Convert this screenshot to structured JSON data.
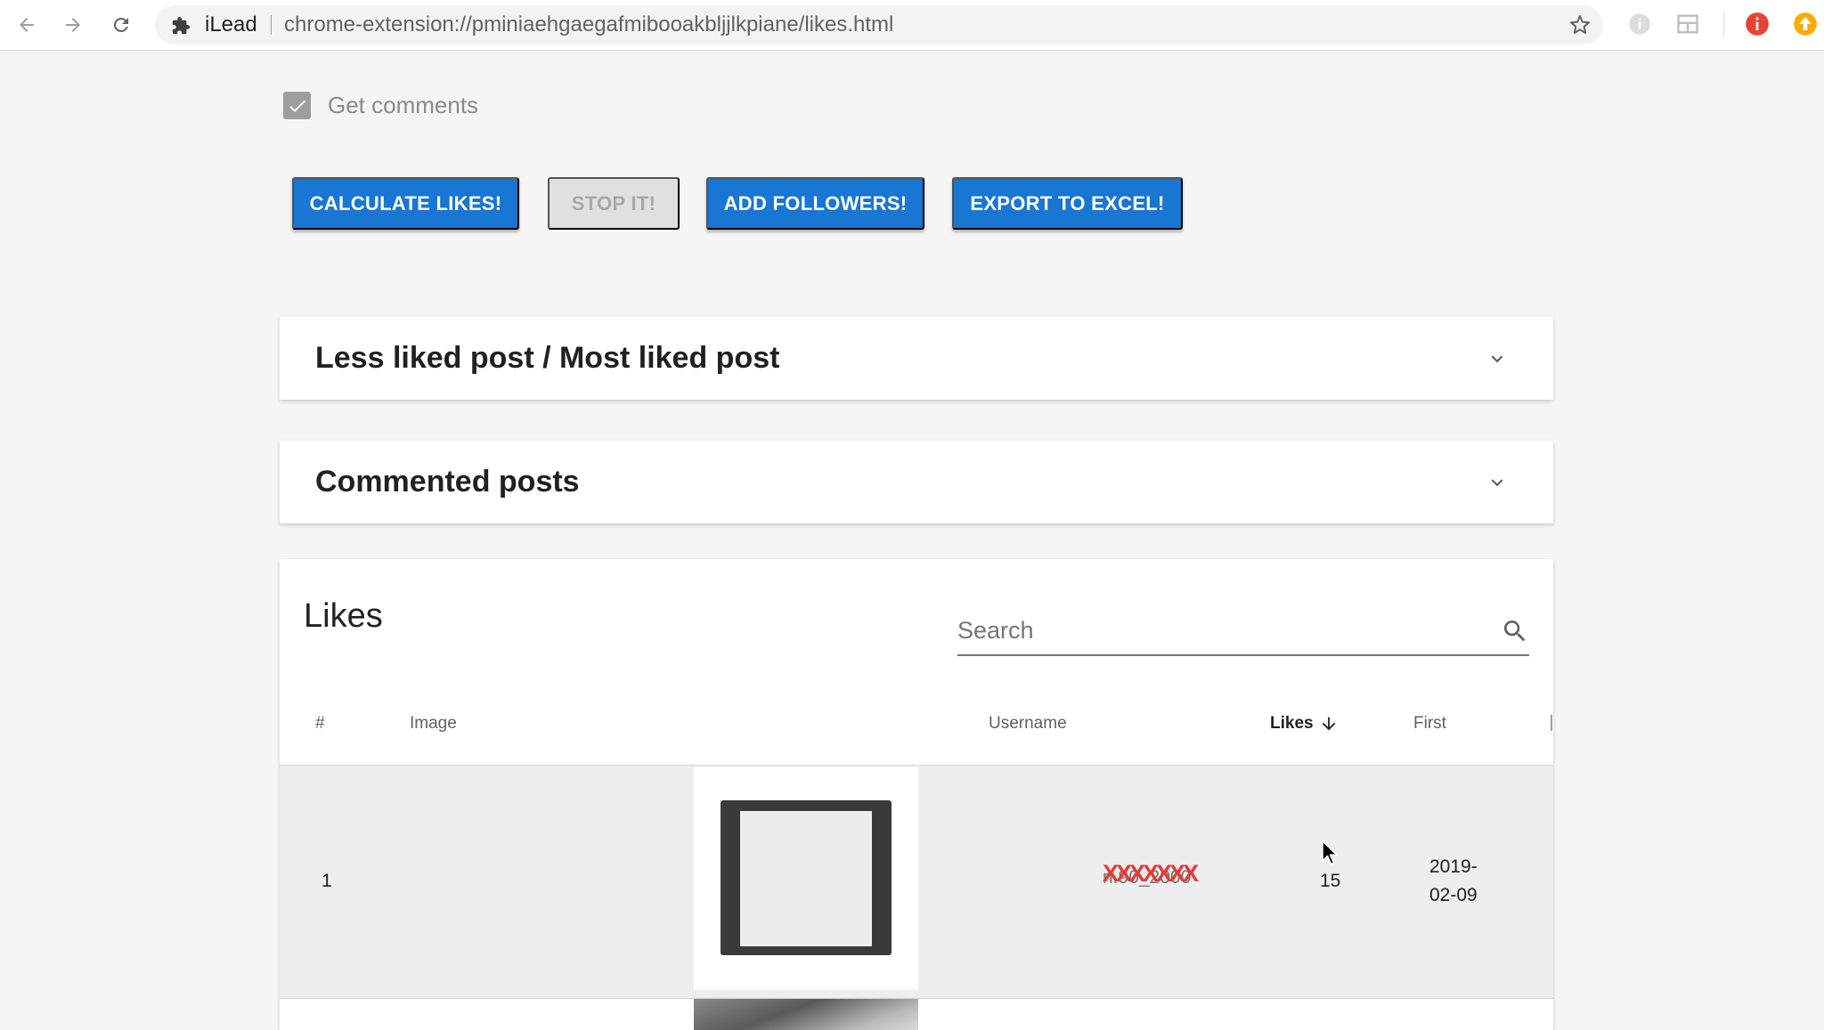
{
  "browser": {
    "extension_name": "iLead",
    "url": "chrome-extension://pminiaehgaegafmibooakbljjlkpiane/likes.html"
  },
  "options": {
    "get_comments_label": "Get comments",
    "get_comments_checked": true
  },
  "actions": {
    "calculate_label": "CALCULATE LIKES!",
    "stop_label": "STOP IT!",
    "add_followers_label": "ADD FOLLOWERS!",
    "export_label": "EXPORT TO EXCEL!"
  },
  "panels": [
    {
      "title": "Less liked post / Most liked post"
    },
    {
      "title": "Commented posts"
    }
  ],
  "likes_table": {
    "title": "Likes",
    "search_placeholder": "Search",
    "columns": [
      "#",
      "Image",
      "Username",
      "Likes",
      "First"
    ],
    "sorted_column": "Likes",
    "sort_direction": "descending",
    "rows": [
      {
        "index": "1",
        "username": "n.90_2000",
        "username_redaction": "XXXXXXX",
        "likes": "15",
        "first": "2019-\n02-09"
      }
    ]
  },
  "colors": {
    "primary": "#1976d2",
    "disabled": "#e0e0e0",
    "redaction": "#e53935"
  },
  "icons": [
    "back-arrow-icon",
    "forward-arrow-icon",
    "reload-icon",
    "puzzle-icon",
    "star-icon",
    "info-icon",
    "layout-icon",
    "info-alert-icon",
    "upload-icon",
    "check-icon",
    "chevron-down-icon",
    "search-icon",
    "arrow-down-icon"
  ]
}
